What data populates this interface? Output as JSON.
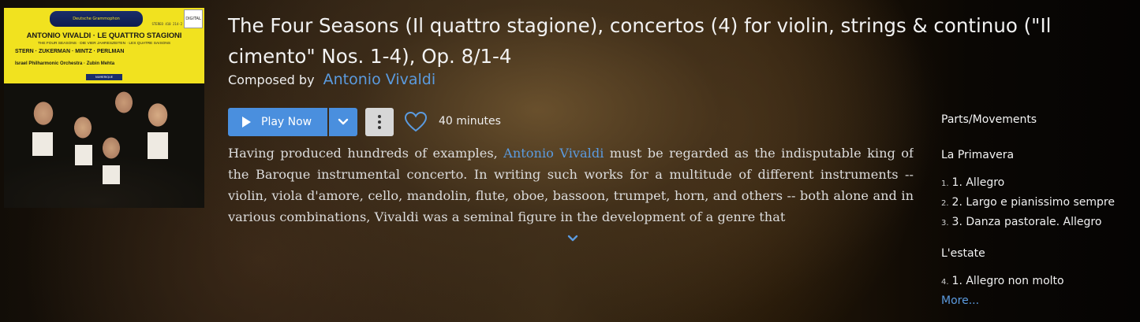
{
  "album": {
    "logo_text": "Deutsche Grammophon",
    "badge": "DIGITAL",
    "stereo_code": "STEREO 410 214-2",
    "cover_title": "ANTONIO VIVALDI · LE QUATTRO STAGIONI",
    "cover_subtitle": "THE FOUR SEASONS · DIE VIER JAHRESZEITEN · LES QUATRE SAISONS",
    "cover_artists": "STERN · ZUKERMAN · MINTZ · PERLMAN",
    "cover_orchestra": "Israel Philharmonic Orchestra · Zubin Mehta",
    "cover_numerique": "NUMERIQUE"
  },
  "header": {
    "title": "The Four Seasons (Il quattro stagione), concertos (4) for violin, strings & continuo (\"Il cimento\" Nos. 1-4), Op. 8/1-4",
    "composed_by_label": "Composed by",
    "composer": "Antonio Vivaldi"
  },
  "controls": {
    "play_now_label": "Play Now",
    "duration": "40 minutes"
  },
  "description": {
    "before_link": "Having produced hundreds of examples, ",
    "link_text": "Antonio Vivaldi",
    "after_link": " must be regarded as the indisputable king of the Baroque instrumental concerto. In writing such works for a multitude of different instruments -- violin, viola d'amore, cello, mandolin, flute, oboe, bassoon, trumpet, horn, and others -- both alone and in various combinations, Vivaldi was a seminal figure in the development of a genre that"
  },
  "sidebar": {
    "heading": "Parts/Movements",
    "groups": [
      {
        "name": "La Primavera",
        "items": [
          {
            "num": "1.",
            "label": "1. Allegro"
          },
          {
            "num": "2.",
            "label": "2. Largo e pianissimo sempre"
          },
          {
            "num": "3.",
            "label": "3. Danza pastorale. Allegro"
          }
        ]
      },
      {
        "name": "L'estate",
        "items": [
          {
            "num": "4.",
            "label": "1. Allegro non molto"
          }
        ]
      }
    ],
    "more_label": "More..."
  },
  "colors": {
    "accent": "#4a8fde",
    "link": "#5b9bdf"
  },
  "icons": {
    "play": "play-icon",
    "dropdown": "chevron-down-icon",
    "more": "more-vertical-icon",
    "favorite": "heart-icon",
    "expand": "chevron-down-icon"
  }
}
